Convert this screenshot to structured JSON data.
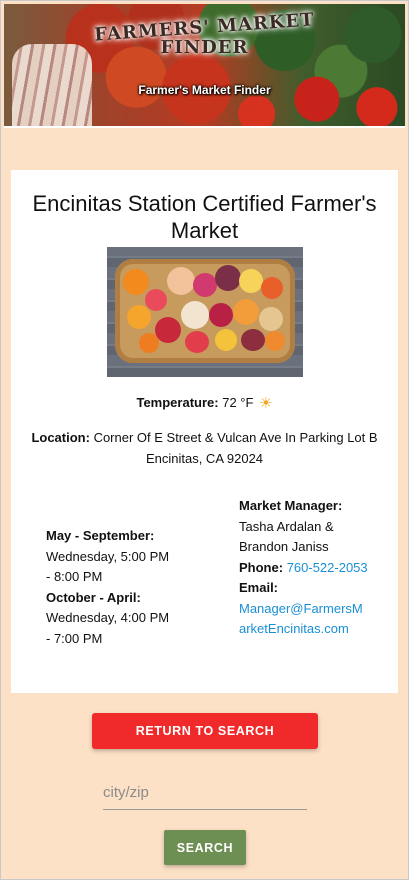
{
  "banner": {
    "logo_line1": "FARMERS' MARKET",
    "logo_line2": "FINDER",
    "caption": "Farmer's Market Finder"
  },
  "market": {
    "name": "Encinitas Station Certified Farmer's Market",
    "weather": {
      "label": "Temperature:",
      "value": "72 °F",
      "icon": "sun-icon"
    },
    "location": {
      "label": "Location:",
      "address_line1": "Corner Of E Street & Vulcan Ave In Parking Lot B",
      "address_line2": "Encinitas, CA 92024"
    },
    "schedule": [
      {
        "season": "May - September:",
        "hours": "Wednesday, 5:00 PM - 8:00 PM"
      },
      {
        "season": "October - April:",
        "hours": "Wednesday, 4:00 PM - 7:00 PM"
      }
    ],
    "contact": {
      "manager_label": "Market Manager:",
      "manager_name": "Tasha Ardalan & Brandon Janiss",
      "phone_label": "Phone:",
      "phone": "760-522-2053",
      "email_label": "Email:",
      "email": "Manager@FarmersMarketEncinitas.com"
    }
  },
  "actions": {
    "return_label": "RETURN TO SEARCH",
    "search_placeholder": "city/zip",
    "search_value": "",
    "search_label": "SEARCH"
  },
  "colors": {
    "page_background": "#fde1c6",
    "return_button": "#f02a2a",
    "search_button": "#6e8f53",
    "link": "#1a8fd6"
  }
}
